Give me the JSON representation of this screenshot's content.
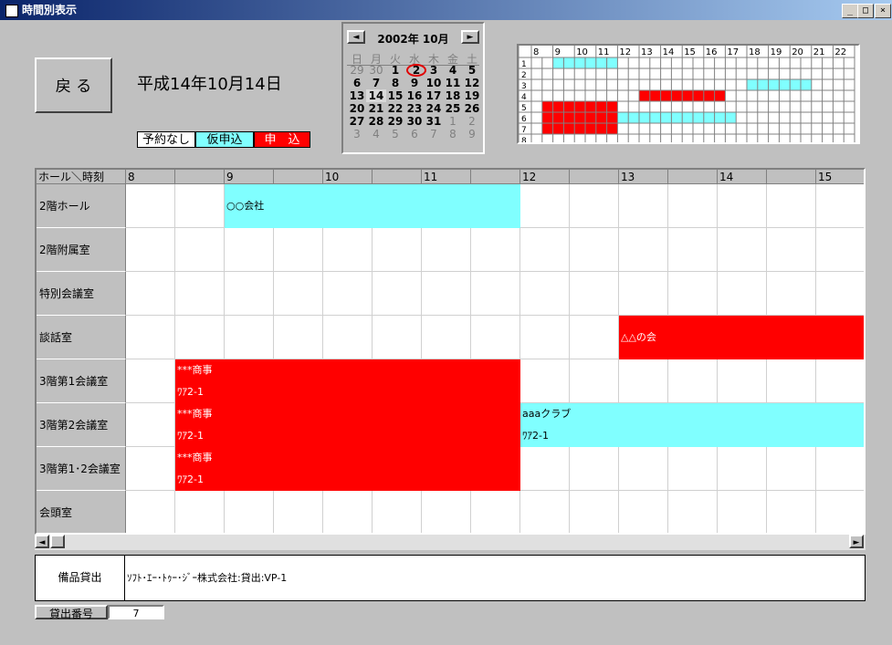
{
  "window": {
    "title": "時間別表示",
    "min": "_",
    "max": "□",
    "close": "×"
  },
  "back_button": "戻 る",
  "date_label": "平成14年10月14日",
  "legend": [
    {
      "label": "予約なし",
      "color": "#ffffff"
    },
    {
      "label": "仮申込",
      "color": "#80ffff"
    },
    {
      "label": "申　込",
      "color": "#ff0000"
    }
  ],
  "calendar": {
    "title": "2002年 10月",
    "prev": "◄",
    "next": "►",
    "dow": [
      "日",
      "月",
      "火",
      "水",
      "木",
      "金",
      "土"
    ],
    "weeks": [
      [
        "29",
        "30",
        "1",
        "2",
        "3",
        "4",
        "5"
      ],
      [
        "6",
        "7",
        "8",
        "9",
        "10",
        "11",
        "12"
      ],
      [
        "13",
        "14",
        "15",
        "16",
        "17",
        "18",
        "19"
      ],
      [
        "20",
        "21",
        "22",
        "23",
        "24",
        "25",
        "26"
      ],
      [
        "27",
        "28",
        "29",
        "30",
        "31",
        "1",
        "2"
      ],
      [
        "3",
        "4",
        "5",
        "6",
        "7",
        "8",
        "9"
      ]
    ],
    "today": "2",
    "selected": "14"
  },
  "mini_grid": {
    "hours": [
      "8",
      "9",
      "10",
      "11",
      "12",
      "13",
      "14",
      "15",
      "16",
      "17",
      "18",
      "19",
      "20",
      "21",
      "22"
    ],
    "rows": [
      "1",
      "2",
      "3",
      "4",
      "5",
      "6",
      "7",
      "8"
    ],
    "bookings": [
      {
        "row": 0,
        "start": 1,
        "end": 4,
        "status": "tentative"
      },
      {
        "row": 2,
        "start": 10,
        "end": 13,
        "status": "tentative"
      },
      {
        "row": 3,
        "start": 5,
        "end": 9,
        "status": "confirmed"
      },
      {
        "row": 4,
        "start": 0.5,
        "end": 4,
        "status": "confirmed"
      },
      {
        "row": 5,
        "start": 0.5,
        "end": 4,
        "status": "confirmed"
      },
      {
        "row": 5,
        "start": 4,
        "end": 9.5,
        "status": "tentative"
      },
      {
        "row": 6,
        "start": 0.5,
        "end": 4,
        "status": "confirmed"
      }
    ]
  },
  "grid": {
    "corner": "ホール＼時刻",
    "hours": [
      "8",
      "",
      "9",
      "",
      "10",
      "",
      "11",
      "",
      "12",
      "",
      "13",
      "",
      "14",
      "",
      "15"
    ],
    "rooms": [
      "2階ホール",
      "2階附属室",
      "特別会議室",
      "談話室",
      "3階第1会議室",
      "3階第2会議室",
      "3階第1･2会議室",
      "会頭室"
    ],
    "bookings": [
      {
        "row": 0,
        "start": 2,
        "end": 8,
        "status": "tentative",
        "line1": "○○会社",
        "line2": ""
      },
      {
        "row": 3,
        "start": 10,
        "end": 15,
        "status": "confirmed",
        "line1": "△△の会",
        "line2": ""
      },
      {
        "row": 4,
        "start": 1,
        "end": 8,
        "status": "confirmed",
        "line1": "***商事",
        "line2": "ﾜｱ2-1"
      },
      {
        "row": 5,
        "start": 1,
        "end": 8,
        "status": "confirmed",
        "line1": "***商事",
        "line2": "ﾜｱ2-1"
      },
      {
        "row": 5,
        "start": 8,
        "end": 15,
        "status": "tentative",
        "line1": "aaaクラブ",
        "line2": "ﾜｱ2-1"
      },
      {
        "row": 6,
        "start": 1,
        "end": 8,
        "status": "confirmed",
        "line1": "***商事",
        "line2": "ﾜｱ2-1"
      }
    ]
  },
  "colors": {
    "tentative": "#80ffff",
    "confirmed": "#ff0000"
  },
  "scroll": {
    "left": "◄",
    "right": "►"
  },
  "equipment": {
    "label": "備品貸出",
    "value": "ｿﾌﾄ･ｴｰ･ﾄｩｰ･ｼﾞｰ株式会社:貸出:VP-1"
  },
  "rental_number": {
    "label": "貸出番号",
    "value": "7"
  }
}
